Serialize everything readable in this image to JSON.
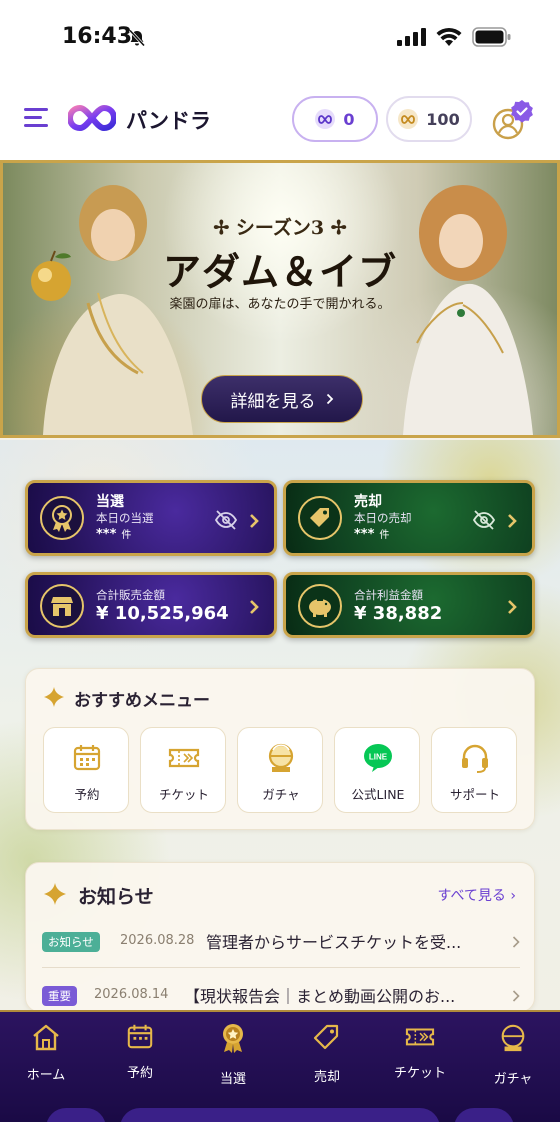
{
  "status_bar": {
    "time": "16:43"
  },
  "header": {
    "brand": "パンドラ",
    "coin_a": "0",
    "coin_b": "100"
  },
  "banner": {
    "season": "✢ シーズン3 ✢",
    "title": "アダム＆イブ",
    "subtitle": "楽園の扉は、あなたの手で開かれる。",
    "button_label": "詳細を見る"
  },
  "cards": {
    "win": {
      "title": "当選",
      "sub": "本日の当選",
      "value": "***",
      "unit": "件"
    },
    "sell": {
      "title": "売却",
      "sub": "本日の売却",
      "value": "***",
      "unit": "件"
    },
    "sales": {
      "sub": "合計販売金額",
      "amount": "¥ 10,525,964"
    },
    "profit": {
      "sub": "合計利益金額",
      "amount": "¥ 38,882"
    }
  },
  "recommended": {
    "title": "おすすめメニュー",
    "items": [
      {
        "label": "予約",
        "icon": "calendar-icon"
      },
      {
        "label": "チケット",
        "icon": "ticket-icon"
      },
      {
        "label": "ガチャ",
        "icon": "gacha-icon"
      },
      {
        "label": "公式LINE",
        "icon": "line-icon"
      },
      {
        "label": "サポート",
        "icon": "headset-icon"
      }
    ]
  },
  "news": {
    "title": "お知らせ",
    "see_all": "すべて見る",
    "items": [
      {
        "tag": "お知らせ",
        "date": "2026.08.28",
        "text": "管理者からサービスチケットを受..."
      },
      {
        "tag": "重要",
        "date": "2026.08.14",
        "text": "【現状報告会｜まとめ動画公開のお..."
      }
    ]
  },
  "nav": {
    "items": [
      {
        "label": "ホーム",
        "icon": "home-icon"
      },
      {
        "label": "予約",
        "icon": "calendar-icon"
      },
      {
        "label": "当選",
        "icon": "medal-icon"
      },
      {
        "label": "売却",
        "icon": "tag-icon"
      },
      {
        "label": "チケット",
        "icon": "ticket-icon"
      },
      {
        "label": "ガチャ",
        "icon": "gacha-icon"
      }
    ]
  },
  "colors": {
    "accent_purple": "#6a3fd1",
    "gold": "#c9a44a",
    "card_purple": "#27145e",
    "card_green": "#0f4020",
    "nav_bg": "#1a0a45",
    "tag_info": "#4caf97",
    "tag_important": "#7a5bd6"
  }
}
